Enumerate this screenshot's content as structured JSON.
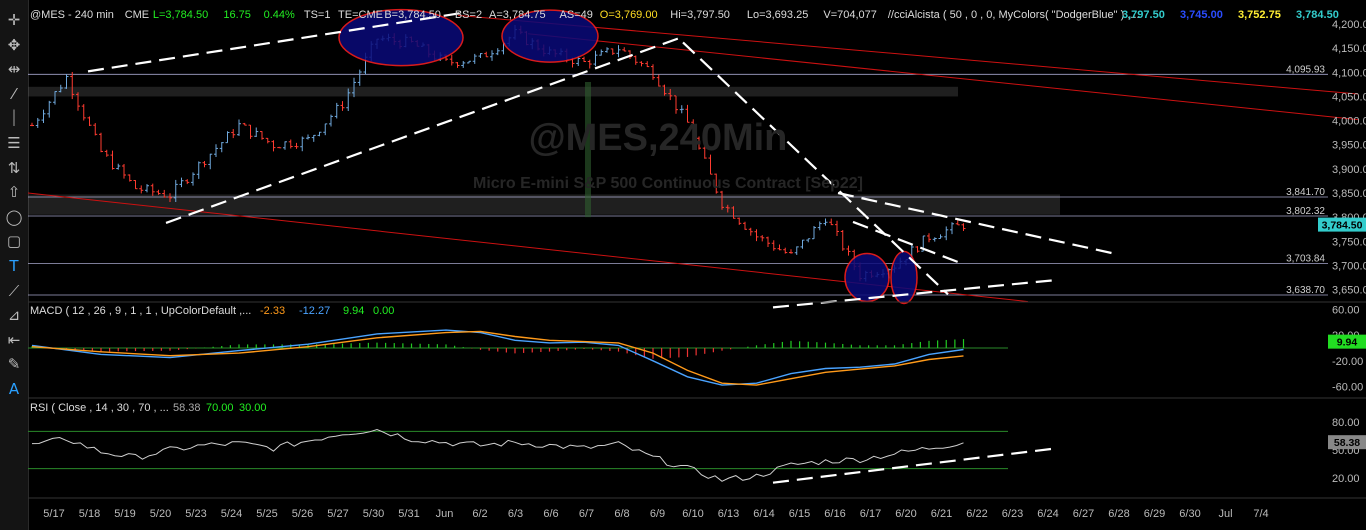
{
  "colors": {
    "background": "#000000",
    "axis_text": "#bbbbbb",
    "up_bar": "#6fa8dc",
    "down_bar": "#ff3b30",
    "ellipse_fill": "#0a0a7a",
    "ellipse_stroke": "#ff2020",
    "trendline": "#ffffff",
    "channel": "#cc1111",
    "hline": "#d0d0ff",
    "zone": "#5a5a5a",
    "macd": "#4aa3ff",
    "macd_signal": "#ff9a1a",
    "macd_hist_up": "#22cc22",
    "macd_hist_down": "#ee3333",
    "rsi": "#d0d0d0",
    "rsi_overbought": "#ff3333",
    "rsi_oversold": "#2244ff",
    "rsi_levels": "#2a8a2a",
    "last_price_tag": "#33cccc",
    "macd_tag": "#22dd22"
  },
  "toolbar": {
    "icons": [
      "crosshair-icon",
      "move-icon",
      "horizontal-arrows-icon",
      "draw-line-icon",
      "vertical-line-icon",
      "horizontal-lines-icon",
      "sort-icon",
      "up-arrow-icon",
      "ellipse-icon",
      "rectangle-icon",
      "text-icon",
      "ray-icon",
      "fibonacci-icon",
      "zoom-icon",
      "pen-icon",
      "label-icon"
    ]
  },
  "header": {
    "symbol": "@MES - 240 min",
    "exchange": "CME",
    "last": "L=3,784.50",
    "change": "16.75",
    "change_pct": "0.44%",
    "ts": "TS=1",
    "te": "TE=CME",
    "bid": "B=3,784.50",
    "bs": "BS=2",
    "ask": "A=3,784.75",
    "as": "AS=49",
    "open": "O=3,769.00",
    "high": "Hi=3,797.50",
    "low": "Lo=3,693.25",
    "volume": "V=704,077",
    "indicator": "//cciAlcista ( 50 , 0 , 0, MyColors( \"DodgerBlue\" ) ,...",
    "vals": [
      "3,797.50",
      "3,745.00",
      "3,752.75",
      "3,784.50"
    ]
  },
  "watermark": {
    "title": "@MES,240Min",
    "subtitle": "Micro E-mini S&P 500 Continuous Contract [Sep22]"
  },
  "price_levels": [
    "3,841.70",
    "3,802.32",
    "3,703.84",
    "3,638.70",
    "4,095.93"
  ],
  "price_axis": [
    "4,200.00",
    "4,150.00",
    "4,100.00",
    "4,050.00",
    "4,000.00",
    "3,950.00",
    "3,900.00",
    "3,850.00",
    "3,800.00",
    "3,750.00",
    "3,700.00",
    "3,650.00"
  ],
  "last_price": "3,784.50",
  "macd": {
    "label": "MACD ( 12 , 26 , 9 , 1 , 1 , UpColorDefault ,...",
    "v1": "-2.33",
    "v2": "-12.27",
    "v3": "9.94",
    "v4": "0.00",
    "axis": [
      "60.00",
      "20.00",
      "-20.00",
      "-60.00"
    ],
    "tag": "9.94"
  },
  "rsi": {
    "label": "RSI ( Close , 14 , 30 , 70 , ...",
    "v1": "58.38",
    "v2": "70.00",
    "v3": "30.00",
    "axis": [
      "80.00",
      "50.00",
      "20.00"
    ],
    "tag": "58.38"
  },
  "chart_data": {
    "type": "candlestick",
    "title": "@MES,240Min",
    "subtitle": "Micro E-mini S&P 500 Continuous Contract [Sep22]",
    "ylim": [
      3620,
      4225
    ],
    "x_ticks": [
      "5/17",
      "5/18",
      "5/19",
      "5/20",
      "5/23",
      "5/24",
      "5/25",
      "5/26",
      "5/27",
      "5/30",
      "5/31",
      "Jun",
      "6/2",
      "6/3",
      "6/6",
      "6/7",
      "6/8",
      "6/9",
      "6/10",
      "6/13",
      "6/14",
      "6/15",
      "6/16",
      "6/17",
      "6/20",
      "6/21",
      "6/22",
      "6/23",
      "6/24",
      "6/27",
      "6/28",
      "6/29",
      "6/30",
      "Jul",
      "7/4"
    ],
    "close_path": [
      [
        0,
        3990
      ],
      [
        1,
        4090
      ],
      [
        2,
        3935
      ],
      [
        3,
        3860
      ],
      [
        4,
        3845
      ],
      [
        5,
        3920
      ],
      [
        6,
        3990
      ],
      [
        7,
        3950
      ],
      [
        8,
        3960
      ],
      [
        9,
        4035
      ],
      [
        10,
        4170
      ],
      [
        11,
        4160
      ],
      [
        12,
        4120
      ],
      [
        13,
        4130
      ],
      [
        14,
        4180
      ],
      [
        15,
        4140
      ],
      [
        16,
        4120
      ],
      [
        17,
        4150
      ],
      [
        18,
        4100
      ],
      [
        19,
        3995
      ],
      [
        20,
        3830
      ],
      [
        21,
        3760
      ],
      [
        22,
        3720
      ],
      [
        23,
        3800
      ],
      [
        24,
        3680
      ],
      [
        25,
        3700
      ],
      [
        26,
        3760
      ],
      [
        27,
        3784.5
      ]
    ],
    "macd_path": [
      [
        0,
        4
      ],
      [
        2,
        -10
      ],
      [
        4,
        -15
      ],
      [
        6,
        -4
      ],
      [
        8,
        6
      ],
      [
        10,
        22
      ],
      [
        12,
        28
      ],
      [
        13,
        24
      ],
      [
        14,
        12
      ],
      [
        15,
        8
      ],
      [
        16,
        9
      ],
      [
        17,
        4
      ],
      [
        18,
        -20
      ],
      [
        19,
        -45
      ],
      [
        20,
        -58
      ],
      [
        21,
        -55
      ],
      [
        22,
        -40
      ],
      [
        23,
        -32
      ],
      [
        24,
        -30
      ],
      [
        25,
        -25
      ],
      [
        26,
        -10
      ],
      [
        27,
        -2.33
      ]
    ],
    "signal_path": [
      [
        0,
        2
      ],
      [
        2,
        -6
      ],
      [
        4,
        -12
      ],
      [
        6,
        -8
      ],
      [
        8,
        2
      ],
      [
        10,
        16
      ],
      [
        12,
        24
      ],
      [
        13,
        26
      ],
      [
        14,
        18
      ],
      [
        15,
        12
      ],
      [
        16,
        10
      ],
      [
        17,
        8
      ],
      [
        18,
        -8
      ],
      [
        19,
        -35
      ],
      [
        20,
        -55
      ],
      [
        21,
        -58
      ],
      [
        22,
        -48
      ],
      [
        23,
        -38
      ],
      [
        24,
        -33
      ],
      [
        25,
        -28
      ],
      [
        26,
        -18
      ],
      [
        27,
        -12.27
      ]
    ],
    "rsi_path": [
      [
        0,
        55
      ],
      [
        1,
        62
      ],
      [
        2,
        48
      ],
      [
        3,
        42
      ],
      [
        4,
        50
      ],
      [
        5,
        55
      ],
      [
        6,
        57
      ],
      [
        7,
        52
      ],
      [
        8,
        60
      ],
      [
        9,
        68
      ],
      [
        10,
        72
      ],
      [
        11,
        62
      ],
      [
        12,
        58
      ],
      [
        13,
        55
      ],
      [
        14,
        58
      ],
      [
        15,
        55
      ],
      [
        16,
        52
      ],
      [
        17,
        56
      ],
      [
        18,
        42
      ],
      [
        19,
        30
      ],
      [
        20,
        18
      ],
      [
        21,
        22
      ],
      [
        22,
        34
      ],
      [
        23,
        38
      ],
      [
        24,
        40
      ],
      [
        25,
        46
      ],
      [
        26,
        52
      ],
      [
        27,
        58.38
      ]
    ],
    "macd_ylim": [
      -75,
      75
    ],
    "rsi_ylim": [
      5,
      95
    ]
  }
}
